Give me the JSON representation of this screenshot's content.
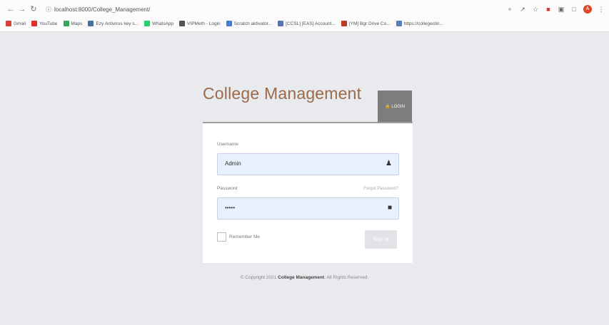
{
  "browser": {
    "url": "localhost:8000/College_Management/",
    "bookmarks": [
      {
        "label": "Gmail",
        "color": "#d44638"
      },
      {
        "label": "YouTube",
        "color": "#e52d27"
      },
      {
        "label": "Maps",
        "color": "#34a853"
      },
      {
        "label": "Ezy Antivirus key s...",
        "color": "#4a6fa5"
      },
      {
        "label": "WhatsApp",
        "color": "#25d366"
      },
      {
        "label": "VIPMeth - Login",
        "color": "#555555"
      },
      {
        "label": "Scratch aktivator...",
        "color": "#4c7ad1"
      },
      {
        "label": "[CCSL] [EAS] Account...",
        "color": "#5573b6"
      },
      {
        "label": "[YM] Bgr Drive Co...",
        "color": "#c0392b"
      },
      {
        "label": "https://collegeclin...",
        "color": "#5a7fb8"
      }
    ]
  },
  "header": {
    "title": "College Management",
    "login_tab": "🔒 LOGIN"
  },
  "form": {
    "username_label": "Username",
    "username_value": "Admin",
    "password_label": "Password",
    "password_value": "•••••",
    "forgot_label": "Forgot Password?",
    "remember_label": "Remember Me",
    "signin_label": "Sign In"
  },
  "footer": {
    "prefix": "© Copyright 2021 ",
    "brand": "College Management",
    "suffix": ". All Rights Reserved."
  },
  "colors": {
    "page_bg": "#e9eaed",
    "title": "#9b6a4a",
    "login_tab": "#7d7d7d",
    "input_bg": "#e8f0fe"
  },
  "icons": {
    "username": "user-icon",
    "password": "lock-icon"
  }
}
